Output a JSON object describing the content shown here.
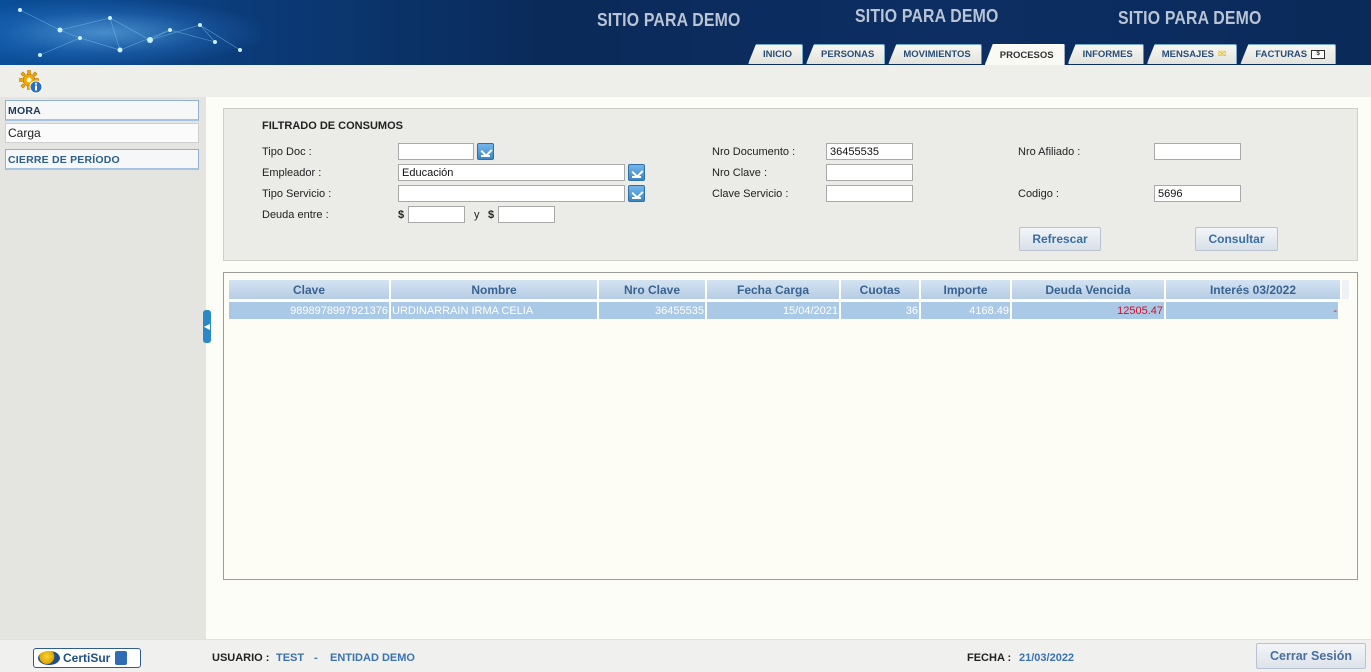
{
  "header": {
    "watermarks": [
      "SITIO PARA DEMO",
      "SITIO PARA DEMO",
      "SITIO PARA DEMO"
    ],
    "tabs": [
      {
        "label": "INICIO",
        "icon": null
      },
      {
        "label": "PERSONAS",
        "icon": null
      },
      {
        "label": "MOVIMIENTOS",
        "icon": null
      },
      {
        "label": "PROCESOS",
        "icon": null,
        "active": true
      },
      {
        "label": "INFORMES",
        "icon": null
      },
      {
        "label": "MENSAJES",
        "icon": "envelope-icon"
      },
      {
        "label": "FACTURAS",
        "icon": "invoice-icon"
      }
    ]
  },
  "sidebar": {
    "sections": [
      {
        "label": "MORA",
        "items": [
          "Carga"
        ]
      },
      {
        "label": "CIERRE DE PERÍODO",
        "items": []
      }
    ]
  },
  "filter": {
    "title": "FILTRADO DE CONSUMOS",
    "tipo_doc": {
      "label": "Tipo Doc :",
      "value": ""
    },
    "empleador": {
      "label": "Empleador :",
      "value": "Educación"
    },
    "tipo_servicio": {
      "label": "Tipo Servicio :",
      "value": ""
    },
    "deuda_entre": {
      "label": "Deuda entre :",
      "currency": "$",
      "sep": "y",
      "from": "",
      "to": ""
    },
    "nro_documento": {
      "label": "Nro Documento :",
      "value": "36455535"
    },
    "nro_clave": {
      "label": "Nro Clave :",
      "value": ""
    },
    "clave_servicio": {
      "label": "Clave Servicio :",
      "value": ""
    },
    "nro_afiliado": {
      "label": "Nro Afiliado :",
      "value": ""
    },
    "codigo": {
      "label": "Codigo :",
      "value": "5696"
    },
    "refresh_label": "Refrescar",
    "query_label": "Consultar"
  },
  "grid": {
    "columns": [
      "Clave",
      "Nombre",
      "Nro Clave",
      "Fecha Carga",
      "Cuotas",
      "Importe",
      "Deuda Vencida",
      "Interés 03/2022"
    ],
    "rows": [
      [
        "9898978997921376",
        "URDINARRAIN IRMA CELIA",
        "36455535",
        "15/04/2021",
        "36",
        "4168.49",
        "12505.47",
        "-"
      ]
    ]
  },
  "footer": {
    "logo_text": "CertiSur",
    "usuario_label": "USUARIO :",
    "usuario": "TEST",
    "sep": "-",
    "entidad": "ENTIDAD DEMO",
    "fecha_label": "FECHA :",
    "fecha": "21/03/2022",
    "logout_label": "Cerrar Sesión"
  },
  "colors": {
    "accent": "#3b72b3",
    "debt": "#d0122a",
    "row_selected": "#a9c9e7"
  }
}
